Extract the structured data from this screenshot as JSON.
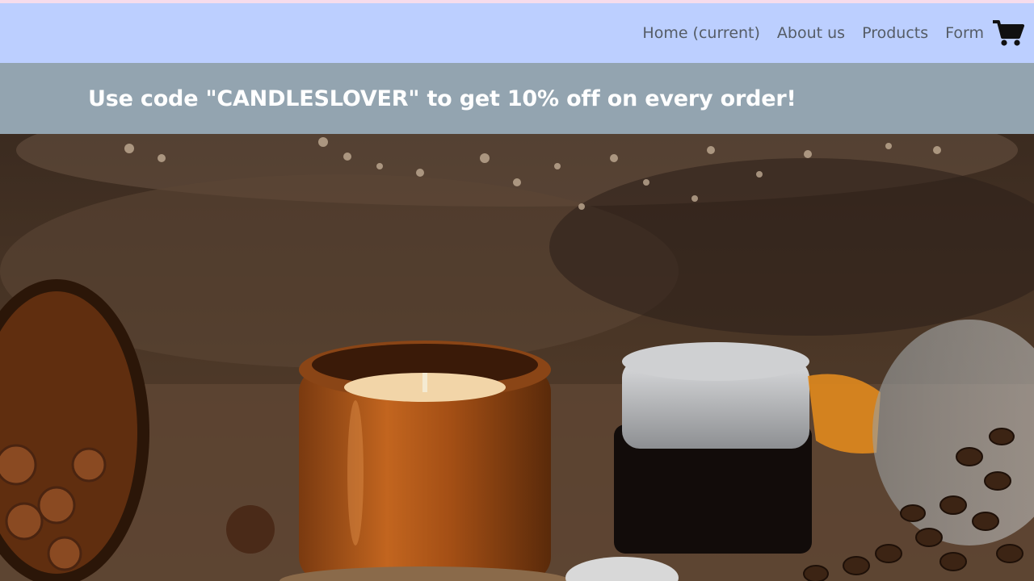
{
  "navbar": {
    "links": [
      {
        "label": "Home (current)"
      },
      {
        "label": "About us"
      },
      {
        "label": "Products"
      },
      {
        "label": "Form"
      }
    ],
    "cart_icon": "shopping-cart-icon",
    "background": "#bccfff"
  },
  "promo": {
    "text": "Use code \"CANDLESLOVER\" to get 10% off on every order!",
    "background": "#93a4b0"
  },
  "hero": {
    "image": "candle-jars-with-cinnamon-and-coffee-beans"
  }
}
